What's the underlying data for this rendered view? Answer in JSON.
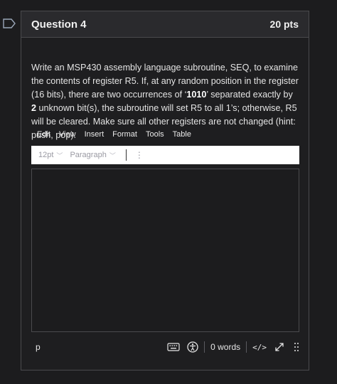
{
  "question": {
    "title": "Question 4",
    "points": "20 pts",
    "prompt_part1": "Write an MSP430 assembly language subroutine, SEQ, to examine the contents of register R5. If, at any random position in the register (16 bits), there are two occurrences of ‘",
    "prompt_bold1": "1010",
    "prompt_part2": "’ separated exactly by ",
    "prompt_bold2": "2",
    "prompt_part3": " unknown bit(s),  the subroutine will set R5 to all 1’s; otherwise, R5 will be cleared. Make sure all other registers are not changed (hint: push, pop)."
  },
  "editor": {
    "menu": [
      "Edit",
      "View",
      "Insert",
      "Format",
      "Tools",
      "Table"
    ],
    "font_size": "12pt",
    "block_format": "Paragraph",
    "status_path": "p",
    "word_count": "0 words",
    "code_view_label": "</>"
  },
  "colors": {
    "background": "#1c1c1e",
    "header": "#2a2a2d",
    "border": "#4a4a4d",
    "toolbar": "#ffffff"
  }
}
